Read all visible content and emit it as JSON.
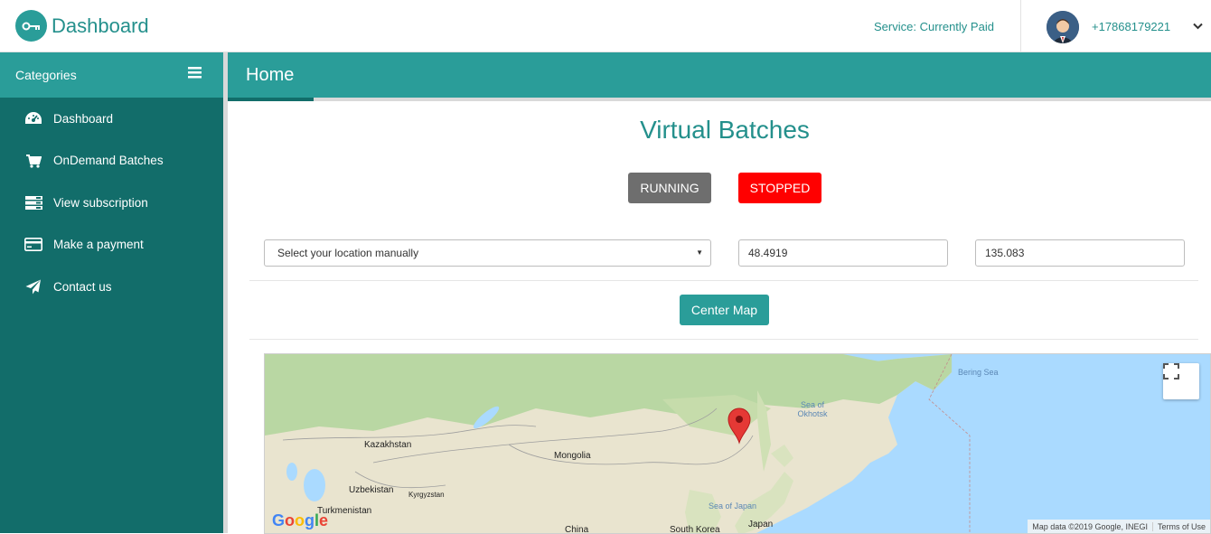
{
  "header": {
    "brand_title": "Dashboard",
    "service_status": "Service: Currently Paid",
    "phone": "+17868179221"
  },
  "sidebar": {
    "title": "Categories",
    "items": [
      {
        "label": "Dashboard",
        "icon": "dashboard-icon"
      },
      {
        "label": "OnDemand Batches",
        "icon": "cart-icon"
      },
      {
        "label": "View subscription",
        "icon": "list-icon"
      },
      {
        "label": "Make a payment",
        "icon": "credit-card-icon"
      },
      {
        "label": "Contact us",
        "icon": "paper-plane-icon"
      }
    ]
  },
  "page": {
    "tab_label": "Home",
    "heading": "Virtual Batches",
    "running_label": "RUNNING",
    "stopped_label": "STOPPED",
    "location_select": "Select your location manually",
    "latitude": "48.4919",
    "longitude": "135.083",
    "center_map_label": "Center Map"
  },
  "map": {
    "labels": {
      "kazakhstan": "Kazakhstan",
      "mongolia": "Mongolia",
      "uzbekistan": "Uzbekistan",
      "kyrgyzstan": "Kyrgyzstan",
      "turkmenistan": "Turkmenistan",
      "china": "China",
      "south_korea": "South Korea",
      "japan": "Japan",
      "sea_of_japan": "Sea of Japan",
      "sea_of_okhotsk": "Sea of Okhotsk",
      "bering_sea": "Bering Sea"
    },
    "logo": "Google",
    "attribution": "Map data ©2019 Google, INEGI",
    "terms": "Terms of Use"
  },
  "colors": {
    "teal": "#2a9d99",
    "sidebar_dark": "#126d6a",
    "running": "#6e6e6e",
    "stopped": "#ff0000",
    "marker": "#e53935"
  }
}
